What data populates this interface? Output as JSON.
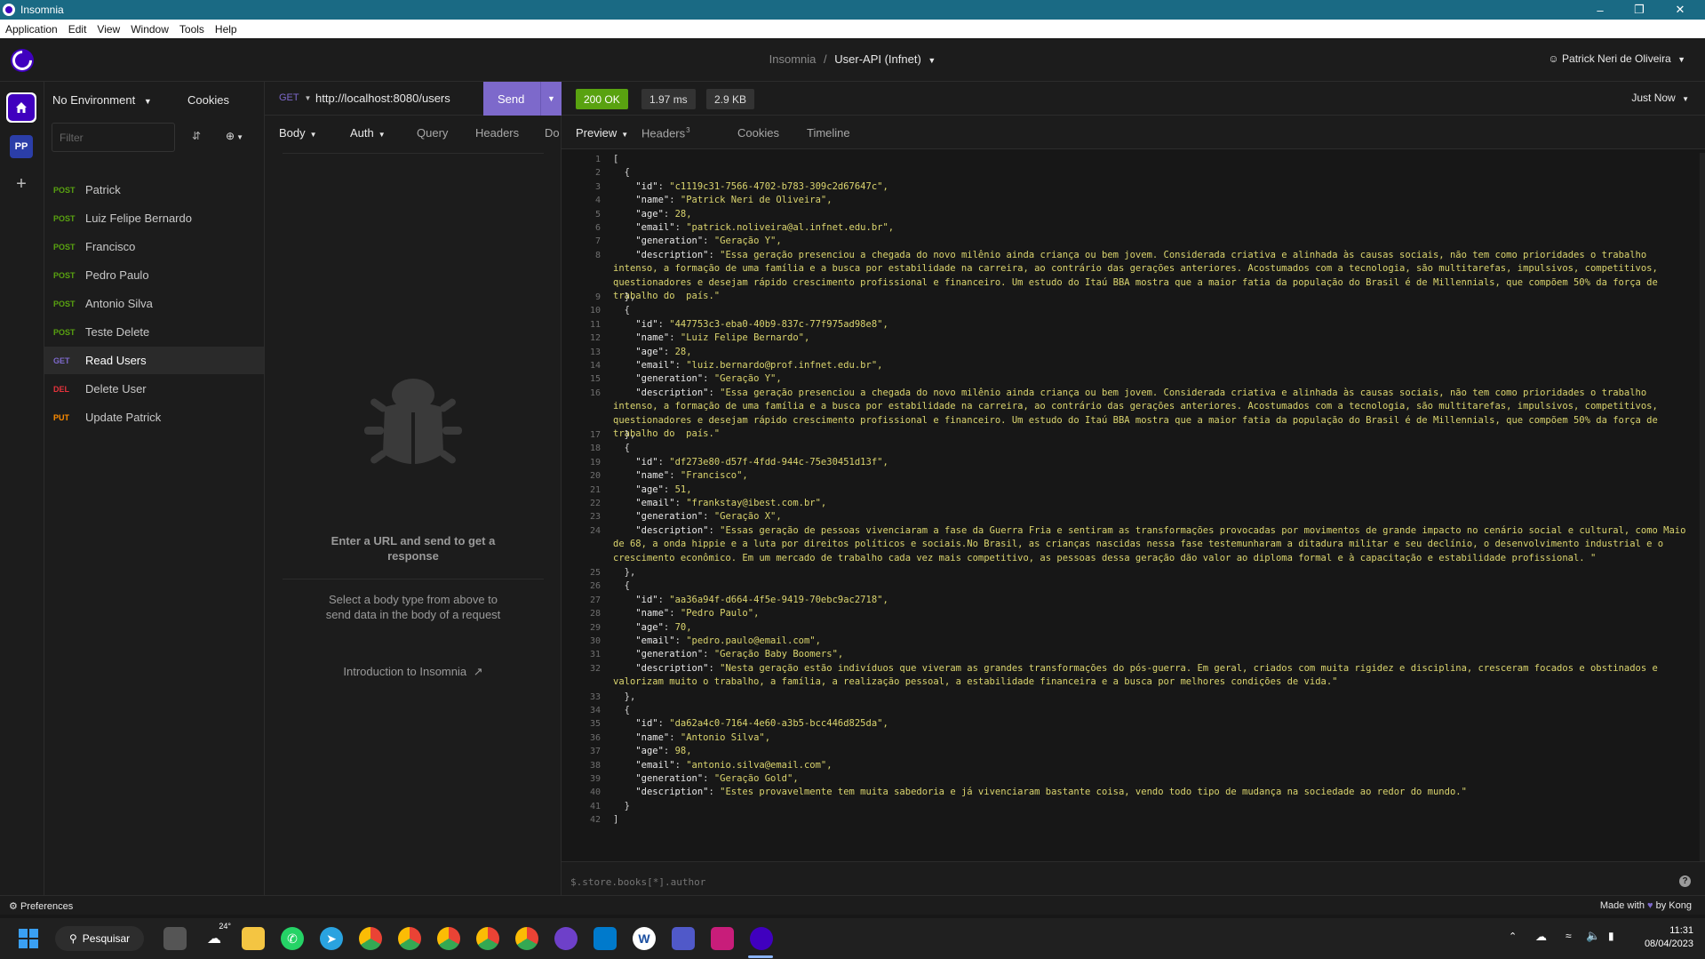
{
  "window": {
    "title": "Insomnia",
    "controls": [
      "minimize",
      "restore",
      "close"
    ]
  },
  "menu": [
    "Application",
    "Edit",
    "View",
    "Window",
    "Tools",
    "Help"
  ],
  "header": {
    "project": "Insomnia",
    "separator": "/",
    "collection": "User-API (Infnet)",
    "user": "Patrick Neri de Oliveira"
  },
  "rail": {
    "home_icon": "home-icon",
    "project_initials": "PP",
    "add_label": "+"
  },
  "sidebar": {
    "environment": "No Environment",
    "cookies": "Cookies",
    "filter_placeholder": "Filter",
    "requests": [
      {
        "method": "POST",
        "name": "Patrick"
      },
      {
        "method": "POST",
        "name": "Luiz Felipe Bernardo"
      },
      {
        "method": "POST",
        "name": "Francisco"
      },
      {
        "method": "POST",
        "name": "Pedro Paulo"
      },
      {
        "method": "POST",
        "name": "Antonio Silva"
      },
      {
        "method": "POST",
        "name": "Teste Delete"
      },
      {
        "method": "GET",
        "name": "Read Users"
      },
      {
        "method": "DEL",
        "name": "Delete User"
      },
      {
        "method": "PUT",
        "name": "Update Patrick"
      }
    ],
    "method_colors": {
      "POST": "#59a210",
      "GET": "#7d69cb",
      "DEL": "#e5333c",
      "PUT": "#ff8c00"
    }
  },
  "request": {
    "method": "GET",
    "url": "http://localhost:8080/users",
    "send": "Send",
    "tabs": {
      "body": "Body",
      "auth": "Auth",
      "query": "Query",
      "headers": "Headers",
      "docs": "Do"
    },
    "empty_title": "Enter a URL and send to get a response",
    "empty_body": "Select a body type from above to send data in the body of a request",
    "intro_link": "Introduction to Insomnia"
  },
  "response": {
    "status": "200 OK",
    "time": "1.97 ms",
    "size": "2.9 KB",
    "when": "Just Now",
    "tabs": {
      "preview": "Preview",
      "headers": "Headers",
      "headers_count": "3",
      "cookies": "Cookies",
      "timeline": "Timeline"
    },
    "filter_placeholder": "$.store.books[*].author",
    "lines": [
      {
        "n": "1",
        "t": "["
      },
      {
        "n": "2",
        "t": "  {"
      },
      {
        "n": "3",
        "t": "    \"id\": \"c1119c31-7566-4702-b783-309c2d67647c\","
      },
      {
        "n": "4",
        "t": "    \"name\": \"Patrick Neri de Oliveira\","
      },
      {
        "n": "5",
        "t": "    \"age\": 28,"
      },
      {
        "n": "6",
        "t": "    \"email\": \"patrick.noliveira@al.infnet.edu.br\","
      },
      {
        "n": "7",
        "t": "    \"generation\": \"Geração Y\","
      },
      {
        "n": "8",
        "t": "    \"description\": \"Essa geração presenciou a chegada do novo milênio ainda criança ou bem jovem. Considerada criativa e alinhada às causas sociais, não tem como prioridades o trabalho intenso, a formação de uma família e a busca por estabilidade na carreira, ao contrário das gerações anteriores. Acostumados com a tecnologia, são multitarefas, impulsivos, competitivos, questionadores e desejam rápido crescimento profissional e financeiro. Um estudo do Itaú BBA mostra que a maior fatia da população do Brasil é de Millennials, que compõem 50% da força de trabalho do  país.\""
      },
      {
        "n": "9",
        "t": "  },"
      },
      {
        "n": "10",
        "t": "  {"
      },
      {
        "n": "11",
        "t": "    \"id\": \"447753c3-eba0-40b9-837c-77f975ad98e8\","
      },
      {
        "n": "12",
        "t": "    \"name\": \"Luiz Felipe Bernardo\","
      },
      {
        "n": "13",
        "t": "    \"age\": 28,"
      },
      {
        "n": "14",
        "t": "    \"email\": \"luiz.bernardo@prof.infnet.edu.br\","
      },
      {
        "n": "15",
        "t": "    \"generation\": \"Geração Y\","
      },
      {
        "n": "16",
        "t": "    \"description\": \"Essa geração presenciou a chegada do novo milênio ainda criança ou bem jovem. Considerada criativa e alinhada às causas sociais, não tem como prioridades o trabalho intenso, a formação de uma família e a busca por estabilidade na carreira, ao contrário das gerações anteriores. Acostumados com a tecnologia, são multitarefas, impulsivos, competitivos, questionadores e desejam rápido crescimento profissional e financeiro. Um estudo do Itaú BBA mostra que a maior fatia da população do Brasil é de Millennials, que compõem 50% da força de trabalho do  país.\""
      },
      {
        "n": "17",
        "t": "  },"
      },
      {
        "n": "18",
        "t": "  {"
      },
      {
        "n": "19",
        "t": "    \"id\": \"df273e80-d57f-4fdd-944c-75e30451d13f\","
      },
      {
        "n": "20",
        "t": "    \"name\": \"Francisco\","
      },
      {
        "n": "21",
        "t": "    \"age\": 51,"
      },
      {
        "n": "22",
        "t": "    \"email\": \"frankstay@ibest.com.br\","
      },
      {
        "n": "23",
        "t": "    \"generation\": \"Geração X\","
      },
      {
        "n": "24",
        "t": "    \"description\": \"Essas geração de pessoas vivenciaram a fase da Guerra Fria e sentiram as transformações provocadas por movimentos de grande impacto no cenário social e cultural, como Maio de 68, a onda hippie e a luta por direitos políticos e sociais.No Brasil, as crianças nascidas nessa fase testemunharam a ditadura militar e seu declínio, o desenvolvimento industrial e o crescimento econômico. Em um mercado de trabalho cada vez mais competitivo, as pessoas dessa geração dão valor ao diploma formal e à capacitação e estabilidade profissional. \""
      },
      {
        "n": "25",
        "t": "  },"
      },
      {
        "n": "26",
        "t": "  {"
      },
      {
        "n": "27",
        "t": "    \"id\": \"aa36a94f-d664-4f5e-9419-70ebc9ac2718\","
      },
      {
        "n": "28",
        "t": "    \"name\": \"Pedro Paulo\","
      },
      {
        "n": "29",
        "t": "    \"age\": 70,"
      },
      {
        "n": "30",
        "t": "    \"email\": \"pedro.paulo@email.com\","
      },
      {
        "n": "31",
        "t": "    \"generation\": \"Geração Baby Boomers\","
      },
      {
        "n": "32",
        "t": "    \"description\": \"Nesta geração estão indivíduos que viveram as grandes transformações do pós-guerra. Em geral, criados com muita rigidez e disciplina, cresceram focados e obstinados e valorizam muito o trabalho, a família, a realização pessoal, a estabilidade financeira e a busca por melhores condições de vida.\""
      },
      {
        "n": "33",
        "t": "  },"
      },
      {
        "n": "34",
        "t": "  {"
      },
      {
        "n": "35",
        "t": "    \"id\": \"da62a4c0-7164-4e60-a3b5-bcc446d825da\","
      },
      {
        "n": "36",
        "t": "    \"name\": \"Antonio Silva\","
      },
      {
        "n": "37",
        "t": "    \"age\": 98,"
      },
      {
        "n": "38",
        "t": "    \"email\": \"antonio.silva@email.com\","
      },
      {
        "n": "39",
        "t": "    \"generation\": \"Geração Gold\","
      },
      {
        "n": "40",
        "t": "    \"description\": \"Estes provavelmente tem muita sabedoria e já vivenciaram bastante coisa, vendo todo tipo de mudança na sociedade ao redor do mundo.\""
      },
      {
        "n": "41",
        "t": "  }"
      },
      {
        "n": "42",
        "t": "]"
      }
    ]
  },
  "footer": {
    "preferences": "Preferences",
    "made_with": "Made with",
    "by": "by Kong"
  },
  "taskbar": {
    "search": "Pesquisar",
    "weather": "24°",
    "time": "11:31",
    "date": "08/04/2023",
    "apps": [
      "task-view-icon",
      "weather-icon",
      "file-explorer-icon",
      "whatsapp-icon",
      "telegram-icon",
      "chrome-icon",
      "chrome-icon",
      "chrome-icon",
      "chrome-icon",
      "chrome-icon",
      "github-icon",
      "vscode-icon",
      "app-w-icon",
      "teams-icon",
      "intellij-icon",
      "insomnia-icon"
    ]
  },
  "colors": {
    "accent": "#7d69cb",
    "status_ok": "#59a210",
    "titlebar": "#1a6a84",
    "json_string": "#dbd56e"
  }
}
